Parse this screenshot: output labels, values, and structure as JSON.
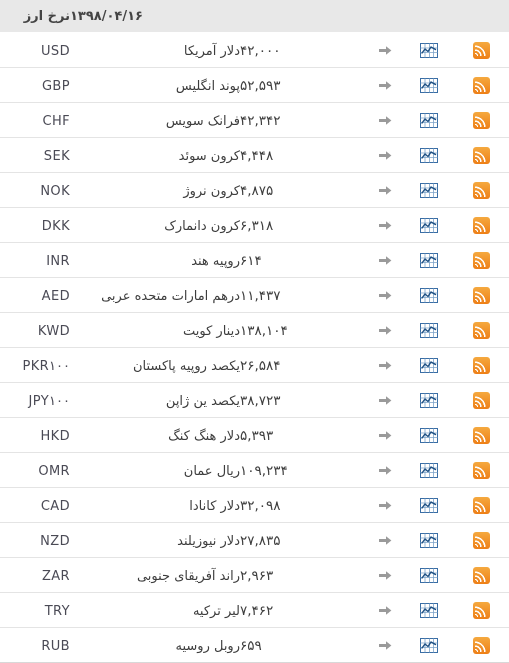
{
  "header": {
    "title": "نرخ ارز",
    "date": "۱۳۹۸/۰۴/۱۶",
    "rss_column_label": "",
    "chart_column_label": "",
    "detail_column_label": ""
  },
  "icons": {
    "rss": "rss-feed-icon",
    "chart": "line-chart-icon",
    "arrow": "arrow-right-icon"
  },
  "colors": {
    "header_background": "#e8e8e8",
    "rss_orange": "#ee7f17",
    "chart_blue": "#2f6fa8",
    "arrow_gray": "#9a9a9a",
    "row_border": "#e4e4e4",
    "text": "#3d3d3d"
  },
  "rows": [
    {
      "code": "USD",
      "name": "دلار آمریکا",
      "value": "۴۲,۰۰۰"
    },
    {
      "code": "GBP",
      "name": "پوند انگلیس",
      "value": "۵۲,۵۹۳"
    },
    {
      "code": "CHF",
      "name": "فرانک سویس",
      "value": "۴۲,۳۴۲"
    },
    {
      "code": "SEK",
      "name": "کرون سوئد",
      "value": "۴,۴۴۸"
    },
    {
      "code": "NOK",
      "name": "کرون نروژ",
      "value": "۴,۸۷۵"
    },
    {
      "code": "DKK",
      "name": "کرون دانمارک",
      "value": "۶,۳۱۸"
    },
    {
      "code": "INR",
      "name": "روپیه هند",
      "value": "۶۱۴"
    },
    {
      "code": "AED",
      "name": "درهم امارات متحده عربی",
      "value": "۱۱,۴۳۷"
    },
    {
      "code": "KWD",
      "name": "دینار کویت",
      "value": "۱۳۸,۱۰۴"
    },
    {
      "code": "PKR۱۰۰",
      "name": "یکصد روپیه پاکستان",
      "value": "۲۶,۵۸۴"
    },
    {
      "code": "JPY۱۰۰",
      "name": "یکصد ین ژاپن",
      "value": "۳۸,۷۲۳"
    },
    {
      "code": "HKD",
      "name": "دلار هنگ کنگ",
      "value": "۵,۳۹۳"
    },
    {
      "code": "OMR",
      "name": "ریال عمان",
      "value": "۱۰۹,۲۳۴"
    },
    {
      "code": "CAD",
      "name": "دلار کانادا",
      "value": "۳۲,۰۹۸"
    },
    {
      "code": "NZD",
      "name": "دلار نیوزیلند",
      "value": "۲۷,۸۳۵"
    },
    {
      "code": "ZAR",
      "name": "راند آفریقای جنوبی",
      "value": "۲,۹۶۳"
    },
    {
      "code": "TRY",
      "name": "لیر ترکیه",
      "value": "۷,۴۶۲"
    },
    {
      "code": "RUB",
      "name": "روبل روسیه",
      "value": "۶۵۹"
    }
  ]
}
